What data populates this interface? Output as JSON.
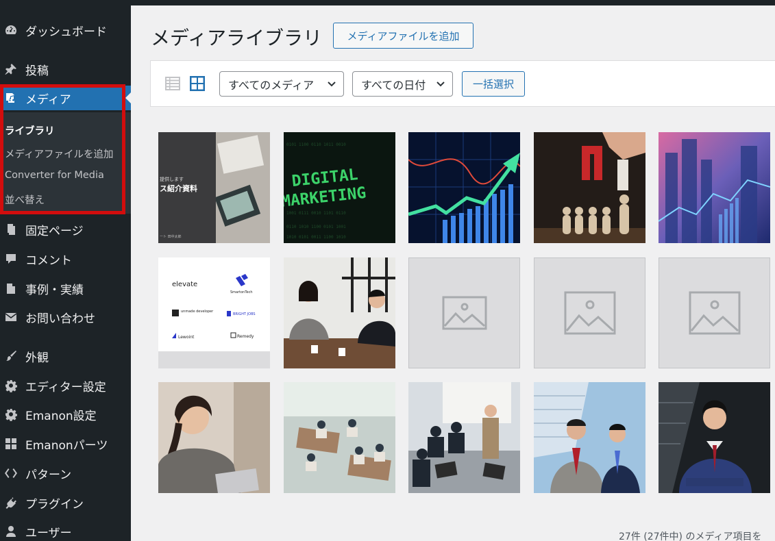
{
  "sidebar": {
    "items": [
      {
        "label": "ダッシュボード",
        "icon": "dashboard-icon"
      },
      {
        "label": "投稿",
        "icon": "pin-icon"
      },
      {
        "label": "メディア",
        "icon": "media-icon"
      },
      {
        "label": "固定ページ",
        "icon": "page-icon"
      },
      {
        "label": "コメント",
        "icon": "comment-icon"
      },
      {
        "label": "事例・実績",
        "icon": "document-icon"
      },
      {
        "label": "お問い合わせ",
        "icon": "mail-icon"
      },
      {
        "label": "外観",
        "icon": "brush-icon"
      },
      {
        "label": "エディター設定",
        "icon": "gear-icon"
      },
      {
        "label": "Emanon設定",
        "icon": "gear-icon"
      },
      {
        "label": "Emanonパーツ",
        "icon": "grid-icon"
      },
      {
        "label": "パターン",
        "icon": "diamond-icon"
      },
      {
        "label": "プラグイン",
        "icon": "plugin-icon"
      },
      {
        "label": "ユーザー",
        "icon": "user-icon"
      }
    ],
    "submenu": [
      {
        "label": "ライブラリ",
        "current": true
      },
      {
        "label": "メディアファイルを追加",
        "current": false
      },
      {
        "label": "Converter for Media",
        "current": false
      },
      {
        "label": "並べ替え",
        "current": false
      }
    ]
  },
  "main": {
    "title": "メディアライブラリ",
    "add_button": "メディアファイルを追加",
    "filters": {
      "media_type": "すべてのメディア",
      "date": "すべての日付"
    },
    "bulk_select": "一括選択",
    "count_text": "27件 (27件中) のメディア項目を",
    "tiles": {
      "t1_text1": "提供します",
      "t1_text2": "ス紹介資料",
      "t1_text3": "ート 田中太郎",
      "t2_text1": "DIGITAL",
      "t2_text2": "MARKETING",
      "t6_logos": [
        "elevate",
        "SmartonTech",
        "unmade developer",
        "BRIGHT JOBS",
        "Lewoint",
        "Remedy"
      ]
    }
  },
  "colors": {
    "sidebar_bg": "#1d2327",
    "active_blue": "#2271b1",
    "highlight_red": "#d20d0d"
  }
}
